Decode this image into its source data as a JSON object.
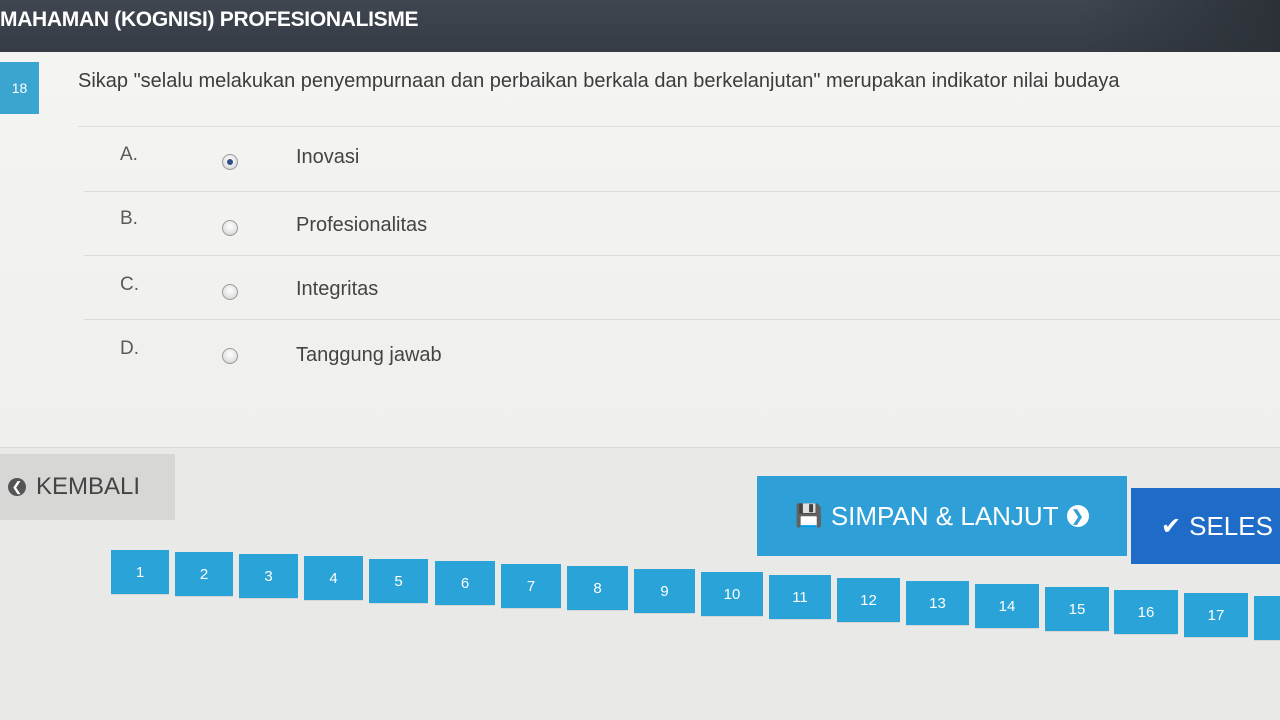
{
  "header": {
    "title": "MAHAMAN (KOGNISI) PROFESIONALISME"
  },
  "question": {
    "number": "18",
    "text": "Sikap \"selalu melakukan penyempurnaan dan perbaikan berkala dan berkelanjutan\" merupakan indikator nilai budaya"
  },
  "options": [
    {
      "letter": "A.",
      "text": "Inovasi",
      "selected": true
    },
    {
      "letter": "B.",
      "text": "Profesionalitas",
      "selected": false
    },
    {
      "letter": "C.",
      "text": "Integritas",
      "selected": false
    },
    {
      "letter": "D.",
      "text": "Tanggung jawab",
      "selected": false
    }
  ],
  "actions": {
    "back_label": "KEMBALI",
    "save_label": "SIMPAN & LANJUT",
    "finish_label": "SELES"
  },
  "icons": {
    "back": "arrow-left-circle-icon",
    "save": "floppy-disk-icon",
    "next": "arrow-right-circle-icon",
    "finish": "check-icon"
  },
  "colors": {
    "header_bg": "#363c45",
    "accent": "#2f9fd8",
    "finish_bg": "#1f6cc8",
    "back_bg": "#d7d8d6"
  },
  "pages": [
    "1",
    "2",
    "3",
    "4",
    "5",
    "6",
    "7",
    "8",
    "9",
    "10",
    "11",
    "12",
    "13",
    "14",
    "15",
    "16",
    "17"
  ]
}
